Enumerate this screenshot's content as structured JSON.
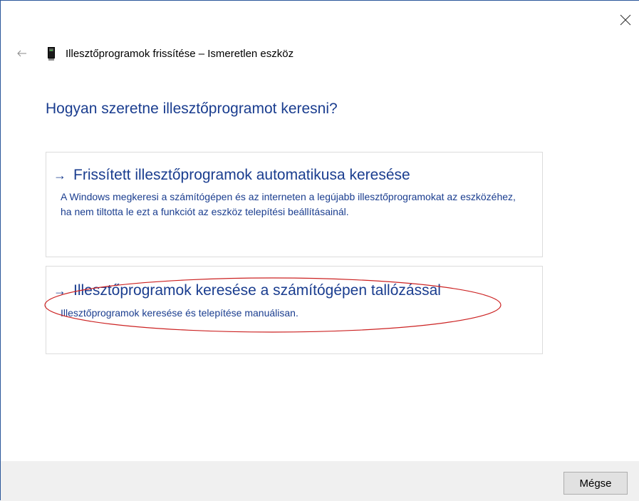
{
  "window": {
    "title": "Illesztőprogramok frissítése – Ismeretlen eszköz"
  },
  "main": {
    "heading": "Hogyan szeretne illesztőprogramot keresni?",
    "options": [
      {
        "arrow": "→",
        "title": "Frissített illesztőprogramok automatikusa keresése",
        "description": "A Windows megkeresi a számítógépen és az interneten a legújabb illesztőprogramokat az eszközéhez, ha nem tiltotta le ezt a funkciót az eszköz telepítési beállításainál."
      },
      {
        "arrow": "→",
        "title": "Illesztőprogramok keresése a számítógépen tallózással",
        "description": "Illesztőprogramok keresése és telepítése manuálisan."
      }
    ]
  },
  "footer": {
    "cancel_label": "Mégse"
  },
  "colors": {
    "link": "#1a3d8f",
    "annotation": "#cc2222",
    "footer_bg": "#f0f0f0"
  },
  "icons": {
    "close": "close-icon",
    "back": "back-arrow-icon",
    "device": "device-icon"
  }
}
